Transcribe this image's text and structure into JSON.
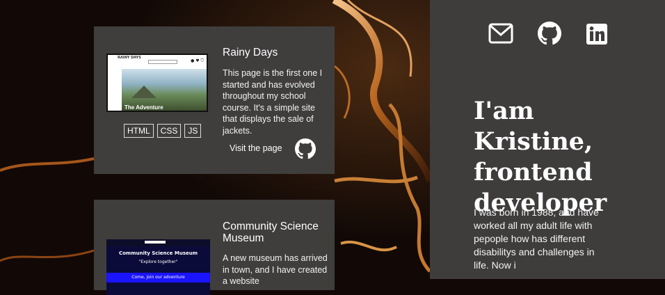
{
  "projects": [
    {
      "title": "Rainy Days",
      "description": "This page is the first one I started and has evolved throughout my school course. It's a simple site that displays the sale of jackets.",
      "tags": [
        "HTML",
        "CSS",
        "JS"
      ],
      "visit_label": "Visit the page",
      "thumbnail": {
        "logo": "RAINY DAYS",
        "hero_text": "The Adventure"
      }
    },
    {
      "title": "Community Science Museum",
      "description": "A new museum has arrived in town, and I have created a website",
      "thumbnail": {
        "heading": "Community Science Museum",
        "subheading": "\"Explore together\"",
        "banner": "Come, join our adventure"
      }
    }
  ],
  "social": {
    "icons": [
      "mail-icon",
      "github-icon",
      "linkedin-icon"
    ]
  },
  "intro": {
    "headline": "I'am Kristine, frontend developer",
    "bio": "I was born in 1988, and have worked all my adult life with pepople how has different disabilitys and challenges in life. Now i"
  },
  "colors": {
    "card_bg": "#3f3e3d",
    "panel_bg": "#3e3d3c",
    "accent_gold": "#d08a3a"
  }
}
